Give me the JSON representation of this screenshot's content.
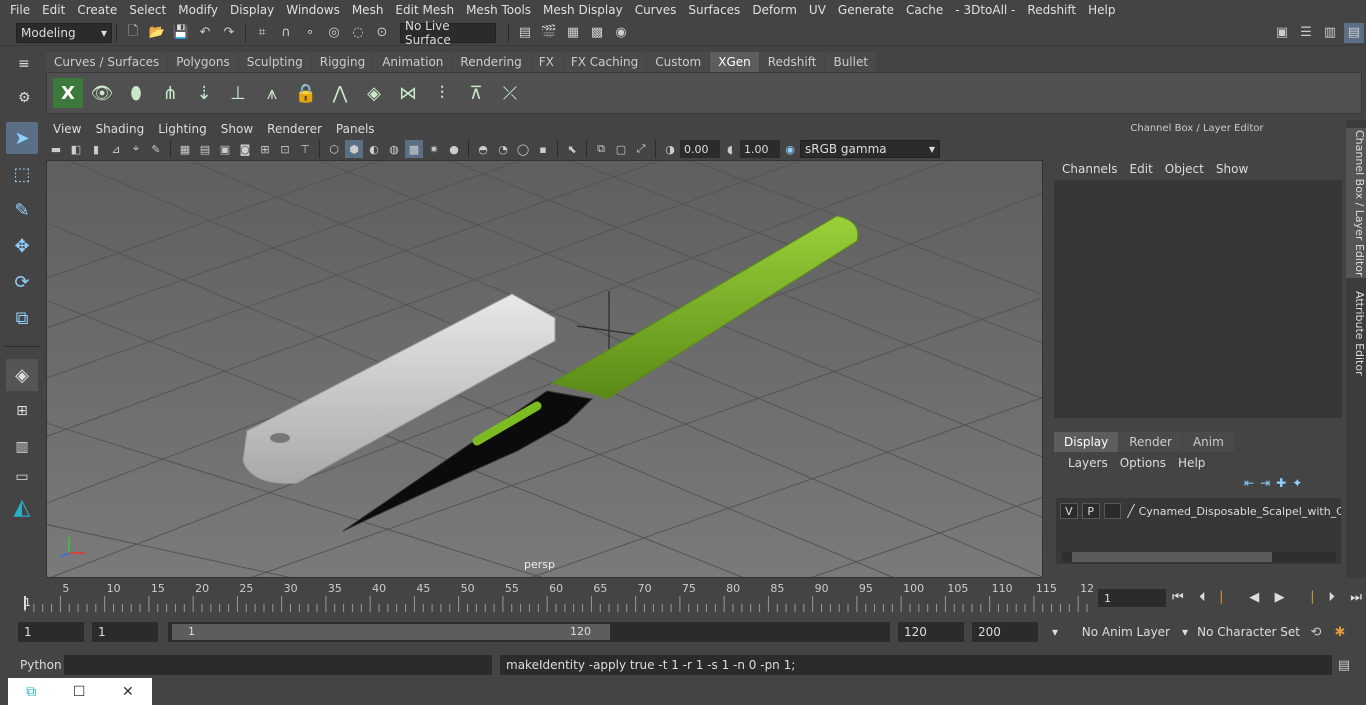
{
  "menubar": [
    "File",
    "Edit",
    "Create",
    "Select",
    "Modify",
    "Display",
    "Windows",
    "Mesh",
    "Edit Mesh",
    "Mesh Tools",
    "Mesh Display",
    "Curves",
    "Surfaces",
    "Deform",
    "UV",
    "Generate",
    "Cache",
    "- 3DtoAll -",
    "Redshift",
    "Help"
  ],
  "statusline": {
    "mode": "Modeling",
    "live_surface": "No Live Surface"
  },
  "shelf_tabs": [
    "Curves / Surfaces",
    "Polygons",
    "Sculpting",
    "Rigging",
    "Animation",
    "Rendering",
    "FX",
    "FX Caching",
    "Custom",
    "XGen",
    "Redshift",
    "Bullet"
  ],
  "shelf_active": "XGen",
  "panel_menu": [
    "View",
    "Shading",
    "Lighting",
    "Show",
    "Renderer",
    "Panels"
  ],
  "panel_toolbar": {
    "exposure": "0.00",
    "gamma": "1.00",
    "color_space": "sRGB gamma"
  },
  "viewport": {
    "camera": "persp"
  },
  "right_panel": {
    "title": "Channel Box / Layer Editor",
    "menu": [
      "Channels",
      "Edit",
      "Object",
      "Show"
    ],
    "tabs": [
      "Display",
      "Render",
      "Anim"
    ],
    "active_tab": "Display",
    "submenu": [
      "Layers",
      "Options",
      "Help"
    ],
    "layer": {
      "v": "V",
      "p": "P",
      "name": "Cynamed_Disposable_Scalpel_with_C"
    }
  },
  "side_tabs": [
    "Channel Box / Layer Editor",
    "Attribute Editor"
  ],
  "timeline": {
    "ticks": [
      "5",
      "10",
      "15",
      "20",
      "25",
      "30",
      "35",
      "40",
      "45",
      "50",
      "55",
      "60",
      "65",
      "70",
      "75",
      "80",
      "85",
      "90",
      "95",
      "100",
      "105",
      "110",
      "115",
      "12"
    ],
    "start_label": "1",
    "current_frame": "1"
  },
  "range": {
    "start": "1",
    "current": "1",
    "slider_start": "1",
    "slider_end": "120",
    "end": "120",
    "max": "200",
    "anim_layer": "No Anim Layer",
    "char_set": "No Character Set"
  },
  "cmdline": {
    "lang": "Python",
    "result": "makeIdentity -apply true -t 1 -r 1 -s 1 -n 0 -pn 1;"
  }
}
